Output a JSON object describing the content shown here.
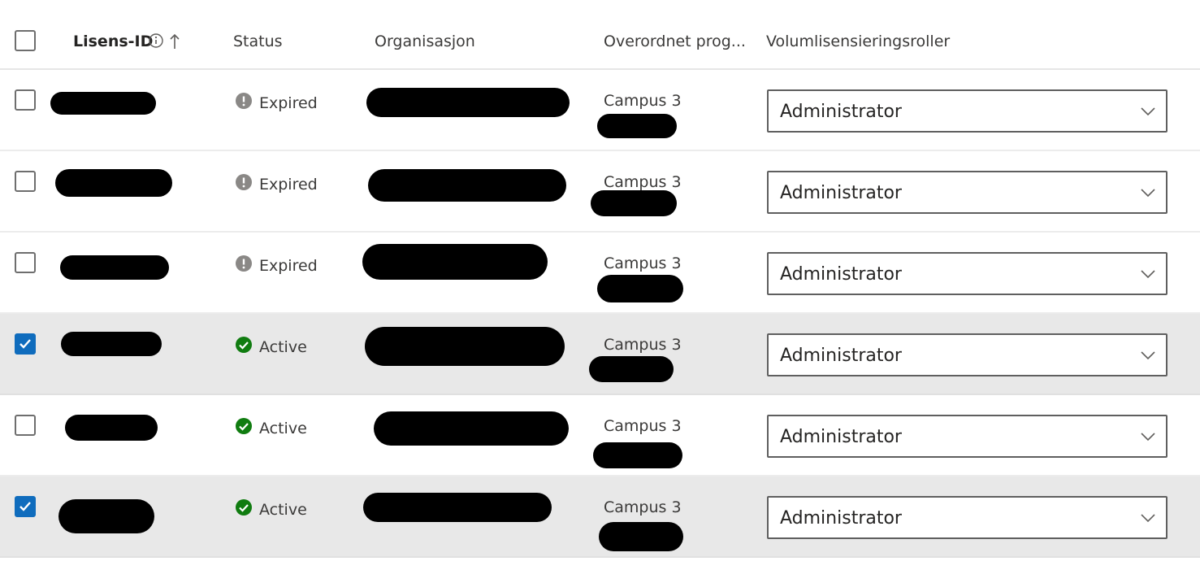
{
  "columns": {
    "license_id": "Lisens-ID",
    "status": "Status",
    "organization": "Organisasjon",
    "parent_program": "Overordnet prog...",
    "roles": "Volumlisensieringsroller"
  },
  "rows": [
    {
      "selected": false,
      "status": "Expired",
      "program": "Campus 3",
      "role": "Administrator"
    },
    {
      "selected": false,
      "status": "Expired",
      "program": "Campus 3",
      "role": "Administrator"
    },
    {
      "selected": false,
      "status": "Expired",
      "program": "Campus 3",
      "role": "Administrator"
    },
    {
      "selected": true,
      "status": "Active",
      "program": "Campus 3",
      "role": "Administrator"
    },
    {
      "selected": false,
      "status": "Active",
      "program": "Campus 3",
      "role": "Administrator"
    },
    {
      "selected": true,
      "status": "Active",
      "program": "Campus 3",
      "role": "Administrator"
    }
  ],
  "colors": {
    "expired_icon": "#8a8886",
    "active_icon": "#107c10",
    "checkbox_checked": "#0f6cbd",
    "selected_row": "#e8e8e8"
  },
  "icons": {
    "info": "info-icon",
    "sort": "sort-ascending-icon",
    "expired": "warning-circle-icon",
    "active": "checkmark-circle-icon",
    "dropdown": "chevron-down-icon",
    "check": "checkmark-icon"
  }
}
